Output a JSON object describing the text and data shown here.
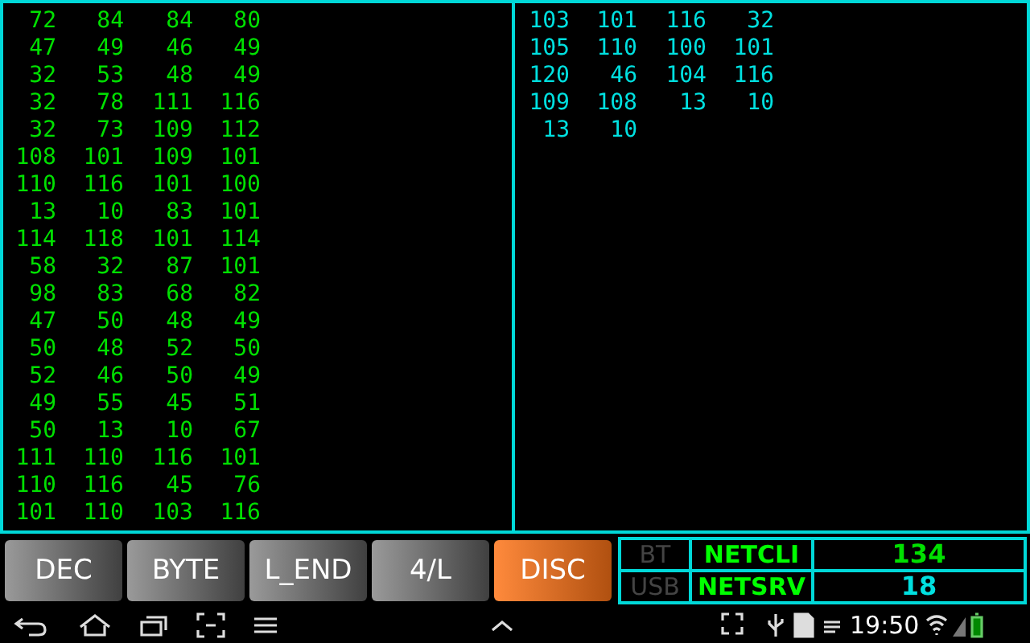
{
  "panels": [
    {
      "color": "#00e000",
      "rows": [
        [
          "72",
          "84",
          "84",
          "80"
        ],
        [
          "47",
          "49",
          "46",
          "49"
        ],
        [
          "32",
          "53",
          "48",
          "49"
        ],
        [
          "32",
          "78",
          "111",
          "116"
        ],
        [
          "32",
          "73",
          "109",
          "112"
        ],
        [
          "108",
          "101",
          "109",
          "101"
        ],
        [
          "110",
          "116",
          "101",
          "100"
        ],
        [
          "13",
          "10",
          "83",
          "101"
        ],
        [
          "114",
          "118",
          "101",
          "114"
        ],
        [
          "58",
          "32",
          "87",
          "101"
        ],
        [
          "98",
          "83",
          "68",
          "82"
        ],
        [
          "47",
          "50",
          "48",
          "49"
        ],
        [
          "50",
          "48",
          "52",
          "50"
        ],
        [
          "52",
          "46",
          "50",
          "49"
        ],
        [
          "49",
          "55",
          "45",
          "51"
        ],
        [
          "50",
          "13",
          "10",
          "67"
        ],
        [
          "111",
          "110",
          "116",
          "101"
        ],
        [
          "110",
          "116",
          "45",
          "76"
        ],
        [
          "101",
          "110",
          "103",
          "116"
        ]
      ]
    },
    {
      "color": "#00e0e0",
      "rows": [
        [
          "103",
          "101",
          "116",
          "32"
        ],
        [
          "105",
          "110",
          "100",
          "101"
        ],
        [
          "120",
          "46",
          "104",
          "116"
        ],
        [
          "109",
          "108",
          "13",
          "10"
        ],
        [
          "13",
          "10"
        ]
      ]
    }
  ],
  "buttons": [
    {
      "label": "DEC",
      "active": false
    },
    {
      "label": "BYTE",
      "active": false
    },
    {
      "label": "L_END",
      "active": false
    },
    {
      "label": "4/L",
      "active": false
    },
    {
      "label": "DISC",
      "active": true
    }
  ],
  "status": [
    {
      "link": {
        "label": "BT",
        "disabled": true
      },
      "mode": {
        "label": "NETCLI"
      },
      "count": "134"
    },
    {
      "link": {
        "label": "USB",
        "disabled": true
      },
      "mode": {
        "label": "NETSRV"
      },
      "count": "18"
    }
  ],
  "system_bar": {
    "time": "19:50"
  }
}
